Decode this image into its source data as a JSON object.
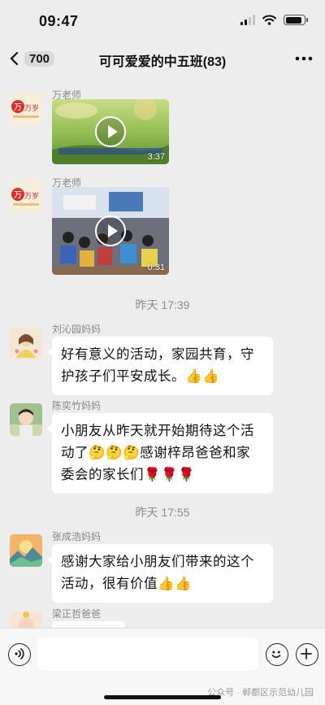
{
  "status": {
    "time": "09:47"
  },
  "header": {
    "back_count": "700",
    "title": "可可爱爱的中五班(83)"
  },
  "messages": [
    {
      "sender": "万老师",
      "type": "video",
      "duration": "3:37"
    },
    {
      "sender": "万老师",
      "type": "video",
      "duration": "0:31"
    },
    {
      "sender": "刘沁园妈妈",
      "lines": [
        "好有意义的活动，家园共育，守",
        "护孩子们平安成长。👍👍"
      ]
    },
    {
      "sender": "陈奕竹妈妈",
      "lines": [
        "小朋友从昨天就开始期待这个活",
        "动了🤔🤔🤔感谢梓昂爸爸和家",
        "委会的家长们🌹🌹🌹"
      ]
    },
    {
      "sender": "张成浩妈妈",
      "lines": [
        "感谢大家给小朋友们带来的这个",
        "活动，很有价值👍👍"
      ]
    },
    {
      "sender": "梁正哲爸爸"
    }
  ],
  "time_dividers": [
    "昨天 17:39",
    "昨天 17:55"
  ],
  "footer": {
    "watermark": "公众号 · 郸都区示范幼儿园"
  },
  "colors": {
    "background": "#ededed",
    "bubble": "#ffffff"
  }
}
